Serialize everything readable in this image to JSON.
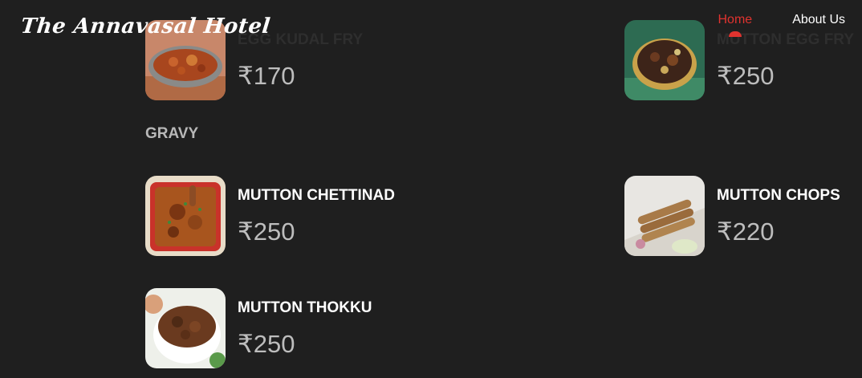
{
  "header": {
    "logo": "The Annavasal Hotel",
    "nav": [
      {
        "label": "Home",
        "active": true
      },
      {
        "label": "About Us",
        "active": false
      }
    ]
  },
  "colors": {
    "background": "#1f1f1f",
    "accent": "#e0332f",
    "price": "#bdbdbd"
  },
  "menu": {
    "top_row": [
      {
        "name": "EGG KUDAL FRY",
        "price": "₹170",
        "image": "egg-kudal-fry-photo"
      },
      {
        "name": "MUTTON EGG FRY",
        "price": "₹250",
        "image": "mutton-egg-fry-photo"
      }
    ],
    "sections": [
      {
        "heading": "GRAVY",
        "items": [
          {
            "name": "MUTTON CHETTINAD",
            "price": "₹250",
            "image": "mutton-chettinad-photo"
          },
          {
            "name": "MUTTON CHOPS",
            "price": "₹220",
            "image": "mutton-chops-photo"
          },
          {
            "name": "MUTTON THOKKU",
            "price": "₹250",
            "image": "mutton-thokku-photo"
          }
        ]
      }
    ]
  }
}
